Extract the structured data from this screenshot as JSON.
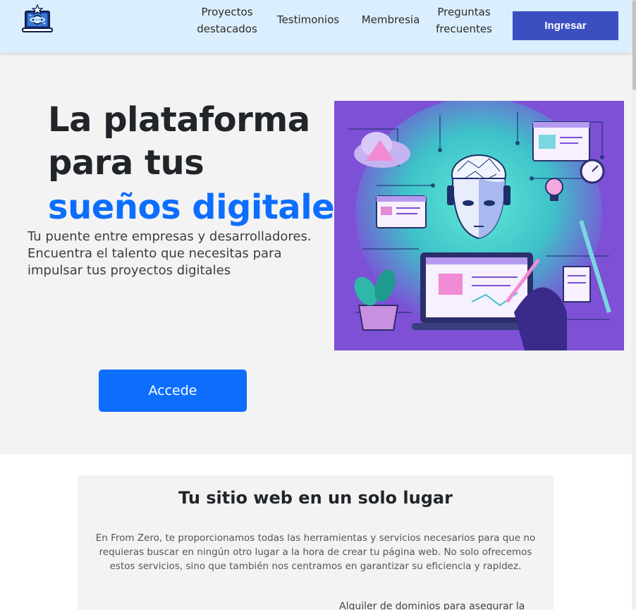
{
  "header": {
    "logo_icon": "laptop-star-logo-icon",
    "nav": [
      "Proyectos\ndestacados",
      "Testimonios",
      "Membresia",
      "Preguntas\nfrecuentes"
    ],
    "login_label": "Ingresar",
    "accent_color": "#3c4fc1",
    "background_color": "#dbeefd"
  },
  "hero": {
    "title_line1": "La plataforma",
    "title_line2": "para tus",
    "title_line3": "sueños digitale",
    "subtitle": "Tu puente entre empresas y desarrolladores. Encuentra el talento que necesitas para impulsar tus proyectos digitales",
    "cta_label": "Accede",
    "accent_color": "#0d6efd",
    "illustration_icon": "ai-robot-digital-illustration-icon"
  },
  "section": {
    "title": "Tu sitio web en un solo lugar",
    "body": "En From Zero, te proporcionamos todas las herramientas y servicios necesarios para que no requieras buscar en ningún otro lugar a la hora de crear tu página web. No solo ofrecemos estos servicios, sino que también nos centramos en garantizar su eficiencia y rapidez.",
    "next_item": "Alquiler de dominios para asegurar la"
  }
}
